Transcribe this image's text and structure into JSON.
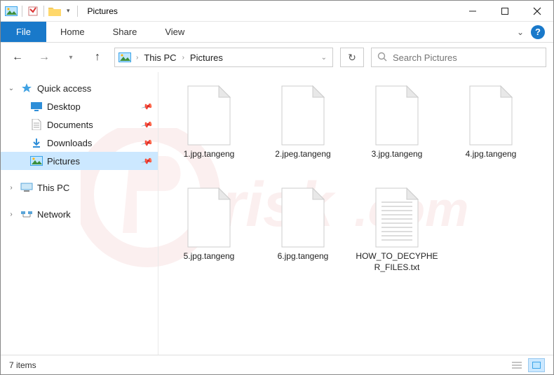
{
  "title": "Pictures",
  "ribbon": {
    "file": "File",
    "tabs": [
      "Home",
      "Share",
      "View"
    ]
  },
  "breadcrumb": [
    "This PC",
    "Pictures"
  ],
  "search": {
    "placeholder": "Search Pictures"
  },
  "sidebar": {
    "quick_access": "Quick access",
    "items": [
      {
        "label": "Desktop"
      },
      {
        "label": "Documents"
      },
      {
        "label": "Downloads"
      },
      {
        "label": "Pictures"
      }
    ],
    "this_pc": "This PC",
    "network": "Network"
  },
  "files": [
    {
      "name": "1.jpg.tangeng",
      "type": "blank"
    },
    {
      "name": "2.jpeg.tangeng",
      "type": "blank"
    },
    {
      "name": "3.jpg.tangeng",
      "type": "blank"
    },
    {
      "name": "4.jpg.tangeng",
      "type": "blank"
    },
    {
      "name": "5.jpg.tangeng",
      "type": "blank"
    },
    {
      "name": "6.jpg.tangeng",
      "type": "blank"
    },
    {
      "name": "HOW_TO_DECYPHER_FILES.txt",
      "type": "text"
    }
  ],
  "status": {
    "count": "7 items"
  },
  "watermark": "pcrisk.com"
}
